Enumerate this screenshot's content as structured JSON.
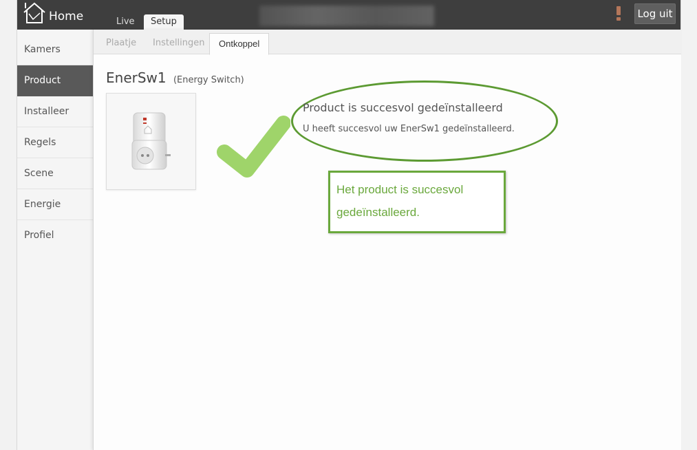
{
  "app": {
    "title": "Home"
  },
  "top_tabs": {
    "live": "Live",
    "setup": "Setup"
  },
  "header": {
    "logout_label": "Log uit",
    "alert_icon": "exclamation-icon"
  },
  "sidebar": {
    "items": [
      {
        "label": "Kamers",
        "active": false
      },
      {
        "label": "Product",
        "active": true
      },
      {
        "label": "Installeer",
        "active": false
      },
      {
        "label": "Regels",
        "active": false
      },
      {
        "label": "Scene",
        "active": false
      },
      {
        "label": "Energie",
        "active": false
      },
      {
        "label": "Profiel",
        "active": false
      }
    ]
  },
  "sub_tabs": {
    "plaatje": "Plaatje",
    "instellingen": "Instellingen",
    "ontkoppel": "Ontkoppel"
  },
  "product": {
    "name": "EnerSw1",
    "type": "(Energy Switch)"
  },
  "status": {
    "heading": "Product is succesvol gedeïnstalleerd",
    "message": "U heeft succesvol uw EnerSw1 gedeïnstalleerd."
  },
  "callout": {
    "text": "Het product is succesvol gedeïnstalleerd."
  },
  "colors": {
    "accent_green": "#6aa83c",
    "check_green": "#9fd46a",
    "topbar": "#3e3e3e",
    "active_sidebar": "#595959"
  }
}
